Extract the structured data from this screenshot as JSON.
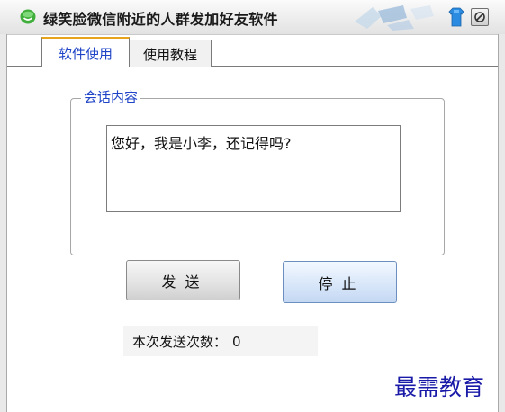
{
  "window": {
    "title": "绿笑脸微信附近的人群发加好友软件",
    "icons": [
      "smiley-app-icon",
      "windows-flag-art",
      "skin-shirt-icon",
      "close-icon"
    ]
  },
  "tabs": [
    {
      "label": "软件使用",
      "active": true
    },
    {
      "label": "使用教程",
      "active": false
    }
  ],
  "session_group": {
    "legend": "会话内容",
    "message_value": "您好，我是小李，还记得吗?"
  },
  "buttons": {
    "send_label": "发送",
    "stop_label": "停止"
  },
  "counter": {
    "label": "本次发送次数：",
    "value": "0"
  },
  "watermark": "最需教育",
  "colors": {
    "tab_active_text": "#1f44c8",
    "tab_active_top_border": "#e7a31c",
    "legend_text": "#1f44c8",
    "watermark": "#1a1aa8",
    "stop_button_tint": "#c4d8f3"
  }
}
